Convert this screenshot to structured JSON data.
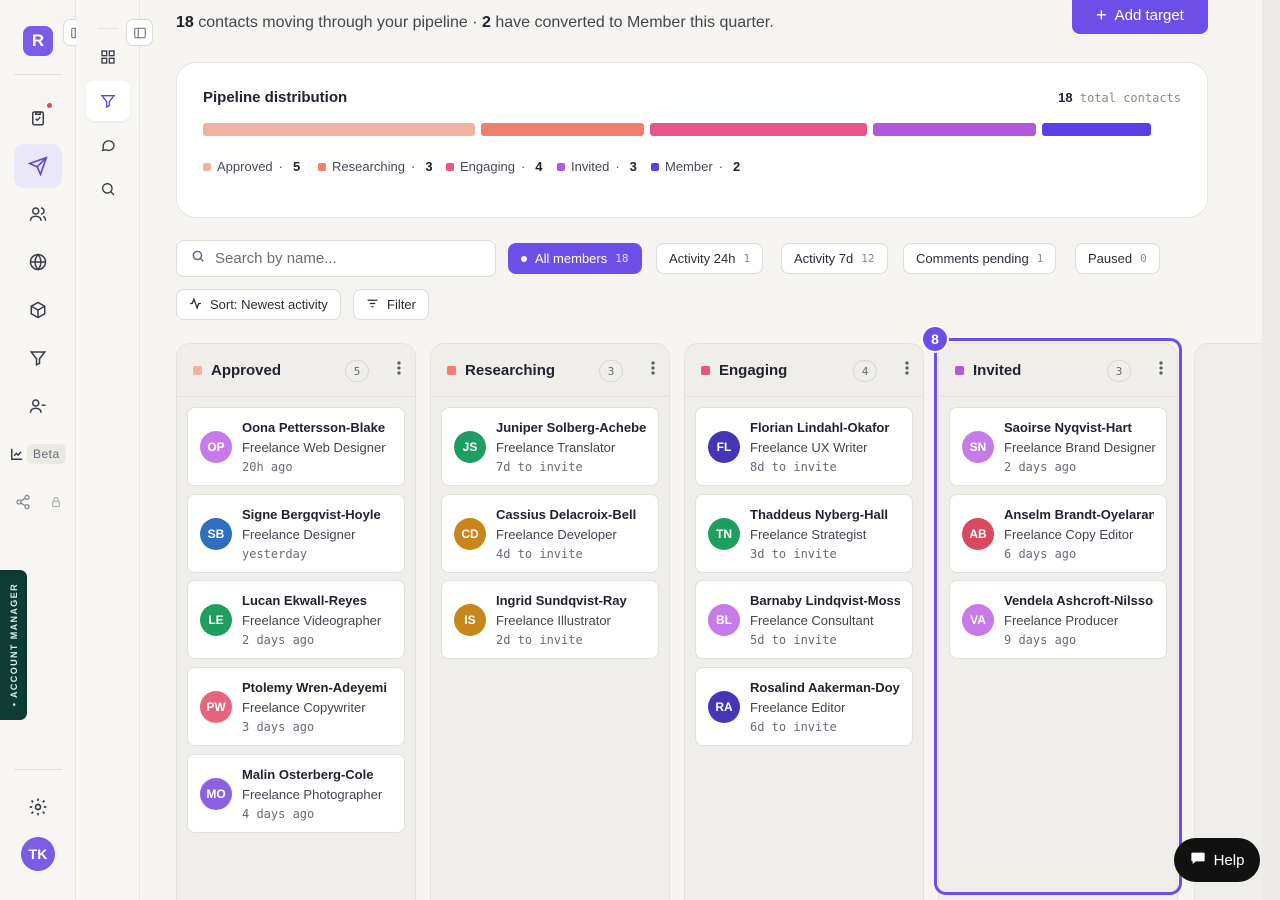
{
  "app": {
    "logo_letter": "R",
    "user_initials": "TK",
    "beta_label": "Beta",
    "account_manager_label": "• ACCOUNT MANAGER",
    "help_label": "Help"
  },
  "header": {
    "contacts_count": "18",
    "contacts_text": "contacts moving through your pipeline ·",
    "converted_count": "2",
    "converted_text": "have converted to Member this quarter.",
    "add_button": "Add target"
  },
  "distribution": {
    "title": "Pipeline distribution",
    "total_value": "18",
    "total_label": "total contacts",
    "stages": [
      {
        "name": "Approved",
        "count": "5",
        "color": "#f2b2a3"
      },
      {
        "name": "Researching",
        "count": "3",
        "color": "#f27e6f"
      },
      {
        "name": "Engaging",
        "count": "4",
        "color": "#e8558a"
      },
      {
        "name": "Invited",
        "count": "3",
        "color": "#b258dc"
      },
      {
        "name": "Member",
        "count": "2",
        "color": "#5b3ee8"
      }
    ]
  },
  "search": {
    "placeholder": "Search by name..."
  },
  "filters": [
    {
      "label": "All members",
      "count": "18",
      "active": true
    },
    {
      "label": "Activity 24h",
      "count": "1"
    },
    {
      "label": "Activity 7d",
      "count": "12"
    },
    {
      "label": "Comments pending",
      "count": "1"
    },
    {
      "label": "Paused",
      "count": "0"
    }
  ],
  "sort_label": "Sort: Newest activity",
  "filter_label": "Filter",
  "highlight_badge": "8",
  "columns": [
    {
      "name": "Approved",
      "count": "5",
      "color": "#f2b2a3",
      "cards": [
        {
          "initials": "OP",
          "name": "Oona Pettersson-Blake",
          "role": "Freelance Web Designer",
          "time": "20h ago",
          "color": "#c67be8"
        },
        {
          "initials": "SB",
          "name": "Signe Bergqvist-Hoyle",
          "role": "Freelance Designer",
          "time": "yesterday",
          "color": "#2f6fbe"
        },
        {
          "initials": "LE",
          "name": "Lucan Ekwall-Reyes",
          "role": "Freelance Videographer",
          "time": "2 days ago",
          "color": "#1f9e62"
        },
        {
          "initials": "PW",
          "name": "Ptolemy Wren-Adeyemi",
          "role": "Freelance Copywriter",
          "time": "3 days ago",
          "color": "#e6647e"
        },
        {
          "initials": "MO",
          "name": "Malin Osterberg-Cole",
          "role": "Freelance Photographer",
          "time": "4 days ago",
          "color": "#8b63e0"
        }
      ]
    },
    {
      "name": "Researching",
      "count": "3",
      "color": "#f27e6f",
      "cards": [
        {
          "initials": "JS",
          "name": "Juniper Solberg-Achebe",
          "role": "Freelance Translator",
          "time": "7d to invite",
          "color": "#1f9e62"
        },
        {
          "initials": "CD",
          "name": "Cassius Delacroix-Bell",
          "role": "Freelance Developer",
          "time": "4d to invite",
          "color": "#c8861c"
        },
        {
          "initials": "IS",
          "name": "Ingrid Sundqvist-Ray",
          "role": "Freelance Illustrator",
          "time": "2d to invite",
          "color": "#c8861c"
        }
      ]
    },
    {
      "name": "Engaging",
      "count": "4",
      "color": "#e8558a",
      "cards": [
        {
          "initials": "FL",
          "name": "Florian Lindahl-Okafor",
          "role": "Freelance UX Writer",
          "time": "8d to invite",
          "color": "#4735b8"
        },
        {
          "initials": "TN",
          "name": "Thaddeus Nyberg-Hall",
          "role": "Freelance Strategist",
          "time": "3d to invite",
          "color": "#1f9e62"
        },
        {
          "initials": "BL",
          "name": "Barnaby Lindqvist-Moss",
          "role": "Freelance Consultant",
          "time": "5d to invite",
          "color": "#c67be8"
        },
        {
          "initials": "RA",
          "name": "Rosalind Aakerman-Doyle",
          "role": "Freelance Editor",
          "time": "6d to invite",
          "color": "#4735b8"
        }
      ]
    },
    {
      "name": "Invited",
      "count": "3",
      "color": "#b258dc",
      "cards": [
        {
          "initials": "SN",
          "name": "Saoirse Nyqvist-Hart",
          "role": "Freelance Brand Designer",
          "time": "2 days ago",
          "color": "#c67be8"
        },
        {
          "initials": "AB",
          "name": "Anselm Brandt-Oyelaran",
          "role": "Freelance Copy Editor",
          "time": "6 days ago",
          "color": "#d94a5e"
        },
        {
          "initials": "VA",
          "name": "Vendela Ashcroft-Nilsson",
          "role": "Freelance Producer",
          "time": "9 days ago",
          "color": "#c67be8"
        }
      ]
    }
  ]
}
